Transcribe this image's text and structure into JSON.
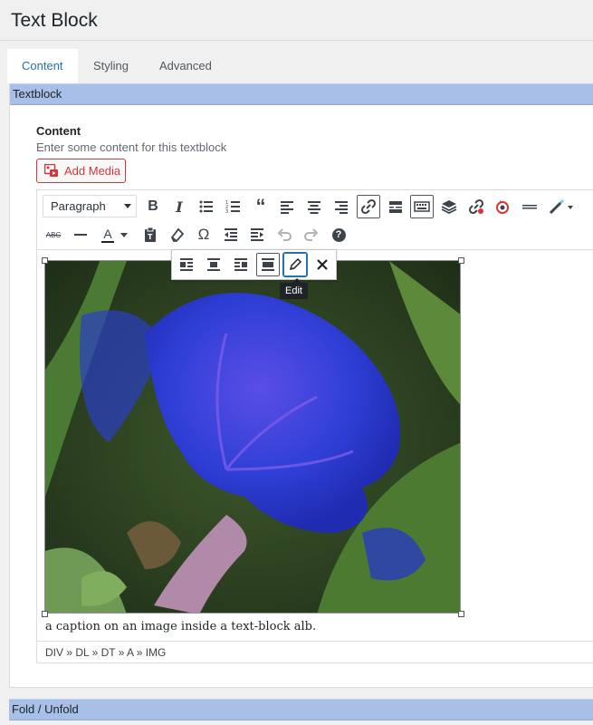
{
  "header": {
    "title": "Text Block"
  },
  "tabs": [
    {
      "label": "Content",
      "active": true
    },
    {
      "label": "Styling",
      "active": false
    },
    {
      "label": "Advanced",
      "active": false
    }
  ],
  "sections": {
    "textblock": "Textblock",
    "fold": "Fold / Unfold"
  },
  "content_field": {
    "label": "Content",
    "description": "Enter some content for this textblock",
    "add_media": "Add Media"
  },
  "editor": {
    "format_select": "Paragraph",
    "toolbar_row1": [
      "bold-icon",
      "italic-icon",
      "bullet-list-icon",
      "numbered-list-icon",
      "blockquote-icon",
      "align-left-icon",
      "align-center-icon",
      "align-right-icon",
      "insert-link-icon",
      "read-more-icon",
      "toolbar-toggle-icon",
      "layers-icon",
      "unlink-icon",
      "target-icon",
      "horizontal-rule-icon",
      "magic-wand-icon"
    ],
    "toolbar_row2": [
      "strikethrough-icon",
      "horizontal-line-icon",
      "text-color-icon",
      "paste-text-icon",
      "clear-formatting-icon",
      "special-character-icon",
      "outdent-icon",
      "indent-icon",
      "undo-icon",
      "redo-icon",
      "help-icon"
    ],
    "strikethrough_glyph": "ABC",
    "text_color_glyph": "A",
    "bold_glyph": "B",
    "italic_glyph": "I",
    "omega_glyph": "Ω",
    "help_glyph": "?",
    "caption": "a caption on an image inside a text-block alb.",
    "image_toolbar_tooltip": "Edit",
    "path": "DIV » DL » DT » A » IMG"
  },
  "colors": {
    "accent": "#2271b1",
    "danger": "#d63638",
    "section_bar": "#a8c0e8"
  }
}
